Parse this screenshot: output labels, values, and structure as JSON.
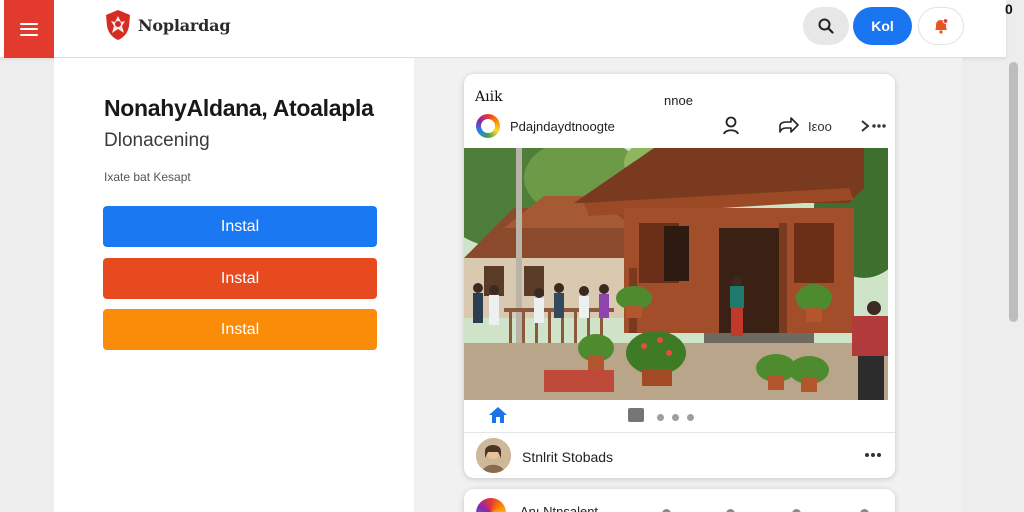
{
  "header": {
    "brand_name": "Noplardag",
    "primary_button_label": "Kol",
    "corner_glyph": "0",
    "icons": {
      "menu": "menu-icon",
      "logo": "shield-logo-icon",
      "search": "search-icon",
      "notification": "bell-icon"
    },
    "colors": {
      "menu_bg": "#e23b2e",
      "primary": "#1976f0",
      "notification_accent": "#e8541f"
    }
  },
  "hero": {
    "title": "NonahyAldana, Atoalapla",
    "subtitle": "Dlonacening",
    "caption": "Ixate bat Kesapt",
    "buttons": [
      {
        "label": "Instal",
        "color": "#1a78f2"
      },
      {
        "label": "Instal",
        "color": "#e84a20"
      },
      {
        "label": "Instal",
        "color": "#fb8c0a"
      }
    ]
  },
  "post": {
    "title": "Aıik",
    "meta": "nnoe",
    "author": "Pdajndaydtnoogte",
    "share_count": "Ιεοο",
    "image_description_icon": "photo-traditional-wooden-house",
    "toolbar_icons": [
      "home-icon",
      "gallery-icon"
    ],
    "comment": {
      "name": "Stnlrit Stobads"
    }
  },
  "next_post": {
    "author": "Anı Ntnsalent"
  }
}
